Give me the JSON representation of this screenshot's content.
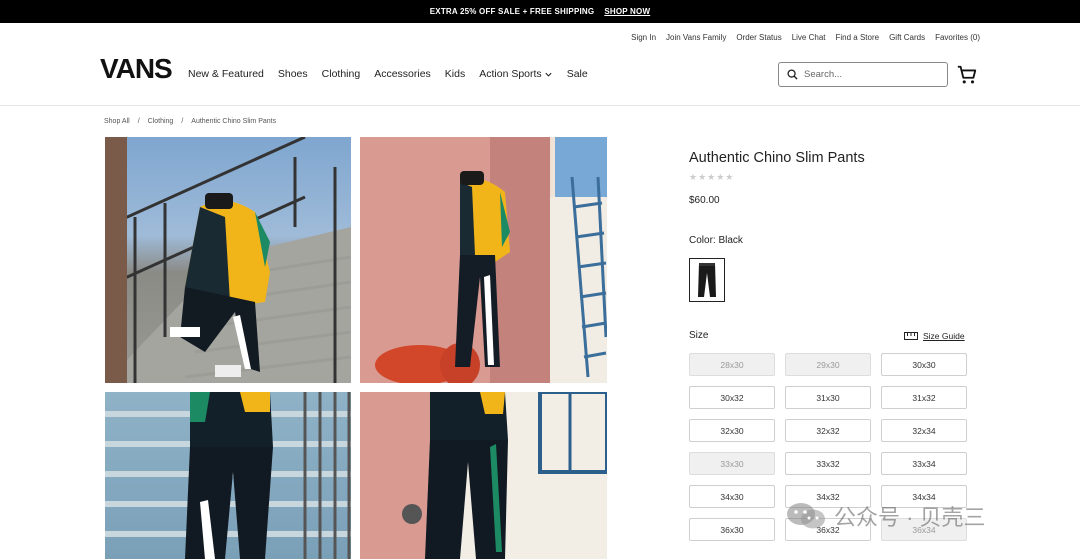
{
  "promo": {
    "text": "EXTRA 25% OFF SALE + FREE SHIPPING",
    "link": "SHOP NOW"
  },
  "utility_links": [
    "Sign In",
    "Join Vans Family",
    "Order Status",
    "Live Chat",
    "Find a Store",
    "Gift Cards",
    "Favorites (0)"
  ],
  "brand": {
    "logo_text": "VANS"
  },
  "nav": [
    "New & Featured",
    "Shoes",
    "Clothing",
    "Accessories",
    "Kids",
    "Action Sports",
    "Sale"
  ],
  "search": {
    "placeholder": "Search..."
  },
  "breadcrumb": [
    "Shop All",
    "/",
    "Clothing",
    "/",
    "Authentic Chino Slim Pants"
  ],
  "product": {
    "title": "Authentic Chino Slim Pants",
    "rating": "★★★★★",
    "price": "$60.00",
    "color_label": "Color: Black",
    "size_label": "Size",
    "size_guide": "Size Guide",
    "sizes": [
      {
        "label": "28x30",
        "available": false
      },
      {
        "label": "29x30",
        "available": false
      },
      {
        "label": "30x30",
        "available": true
      },
      {
        "label": "30x32",
        "available": true
      },
      {
        "label": "31x30",
        "available": true
      },
      {
        "label": "31x32",
        "available": true
      },
      {
        "label": "32x30",
        "available": true
      },
      {
        "label": "32x32",
        "available": true
      },
      {
        "label": "32x34",
        "available": true
      },
      {
        "label": "33x30",
        "available": false
      },
      {
        "label": "33x32",
        "available": true
      },
      {
        "label": "33x34",
        "available": true
      },
      {
        "label": "34x30",
        "available": true
      },
      {
        "label": "34x32",
        "available": true
      },
      {
        "label": "34x34",
        "available": true
      },
      {
        "label": "36x30",
        "available": true
      },
      {
        "label": "36x32",
        "available": true
      },
      {
        "label": "36x34",
        "available": false
      }
    ]
  },
  "watermark": {
    "text": "公众号 · 贝壳三"
  },
  "colors": {
    "promo_bg": "#000000",
    "text": "#222222",
    "border": "#cfcfcf",
    "oos_bg": "#f0f0f0"
  }
}
